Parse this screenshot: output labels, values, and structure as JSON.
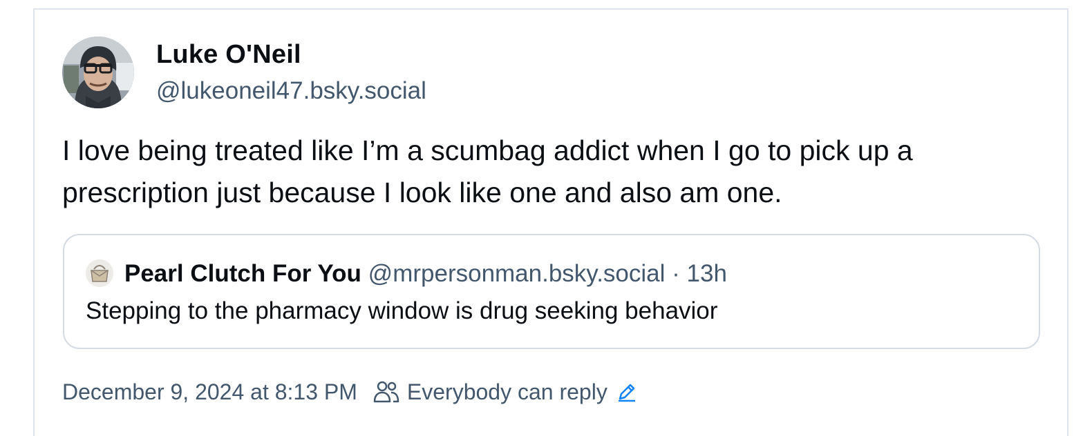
{
  "post": {
    "author": {
      "display_name": "Luke O'Neil",
      "handle": "@lukeoneil47.bsky.social",
      "avatar_icon": "profile-photo"
    },
    "text": "I love being treated like I’m a scumbag addict when I go to pick up a prescription just because I look like one and also am one.",
    "quote": {
      "author": {
        "display_name": "Pearl Clutch For You",
        "handle": "@mrpersonman.bsky.social",
        "avatar_icon": "purse-icon"
      },
      "separator": "·",
      "time": "13h",
      "text": "Stepping to the pharmacy window is drug seeking behavior"
    },
    "meta": {
      "timestamp": "December 9, 2024 at 8:13 PM",
      "reply_setting": "Everybody can reply",
      "reply_icon": "people-icon",
      "edit_icon": "pencil-icon"
    }
  },
  "colors": {
    "text_primary": "#0b0f14",
    "text_secondary": "#42576c",
    "border": "#d4dbe2",
    "accent": "#1083fe"
  }
}
